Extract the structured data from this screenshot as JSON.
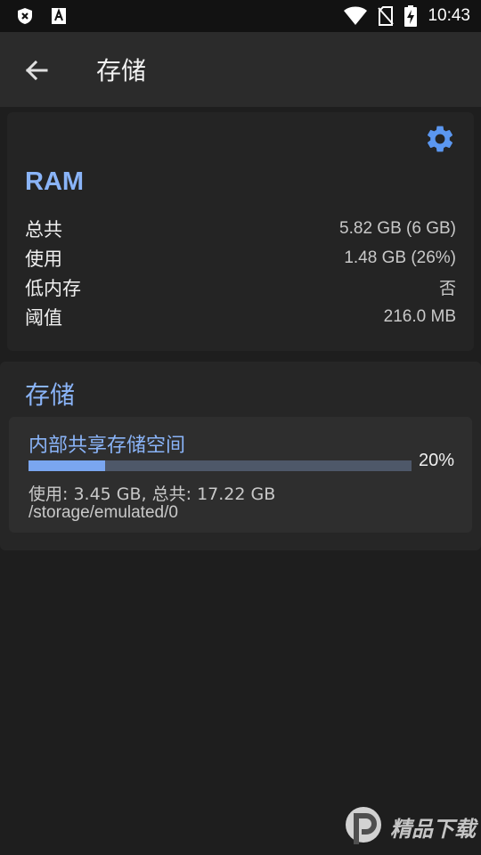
{
  "status_bar": {
    "time": "10:43",
    "left_icons": [
      "shield-x-icon",
      "a-box-icon"
    ],
    "right_icons": [
      "wifi-icon",
      "no-sim-icon",
      "battery-charging-icon"
    ]
  },
  "toolbar": {
    "back_icon": "back-arrow-icon",
    "title": "存储"
  },
  "ram_card": {
    "settings_icon": "gear-icon",
    "title": "RAM",
    "rows": [
      {
        "label": "总共",
        "value": "5.82 GB (6 GB)"
      },
      {
        "label": "使用",
        "value": "1.48 GB (26%)"
      },
      {
        "label": "低内存",
        "value": "否"
      },
      {
        "label": "阈值",
        "value": "216.0 MB"
      }
    ]
  },
  "storage_card": {
    "title": "存储",
    "volumes": [
      {
        "name": "内部共享存储空间",
        "percent_text": "20%",
        "usage_fraction": 0.2,
        "usage": "使用: 3.45 GB, 总共: 17.22 GB",
        "path": "/storage/emulated/0"
      }
    ]
  },
  "colors": {
    "accent": "#8ab4f8",
    "progress_fill": "#7aa6f0",
    "progress_track": "#4e5869",
    "background": "#1e1e1e"
  }
}
